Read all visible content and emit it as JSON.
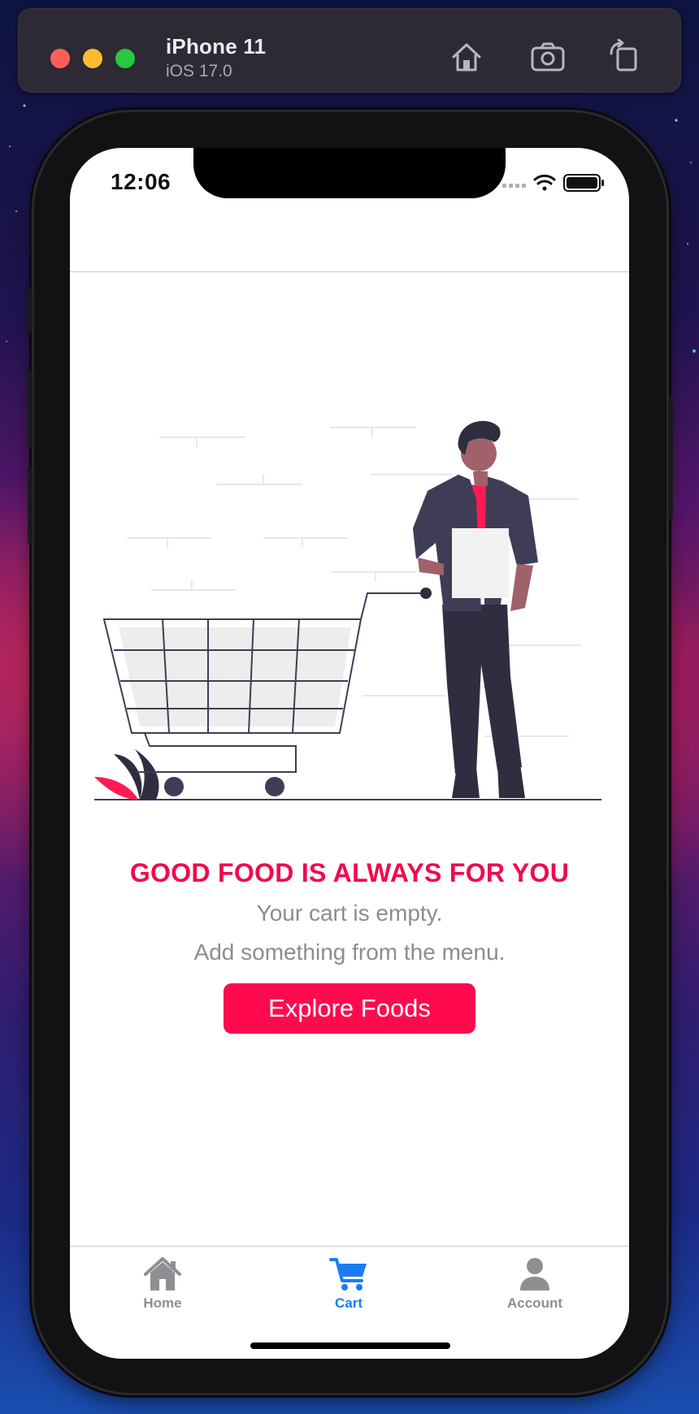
{
  "simulator": {
    "device_name": "iPhone 11",
    "os_version": "iOS 17.0",
    "icons": [
      "home-icon",
      "screenshot-icon",
      "rotate-icon"
    ]
  },
  "status_bar": {
    "time": "12:06",
    "icons": [
      "signal-icon",
      "wifi-icon",
      "battery-icon"
    ]
  },
  "empty_cart": {
    "title": "GOOD FOOD IS ALWAYS FOR YOU",
    "line1": "Your cart is empty.",
    "line2": "Add something from the menu.",
    "button_label": "Explore Foods"
  },
  "tab_bar": {
    "tabs": [
      {
        "label": "Home",
        "icon": "house-icon",
        "active": false
      },
      {
        "label": "Cart",
        "icon": "cart-icon",
        "active": true
      },
      {
        "label": "Account",
        "icon": "person-icon",
        "active": false
      }
    ]
  },
  "colors": {
    "accent": "#ff0a4e",
    "title": "#f0094d",
    "tab_active": "#1a7cf5",
    "tab_inactive": "#8e8e93",
    "illustration_dark": "#2f2e41"
  }
}
